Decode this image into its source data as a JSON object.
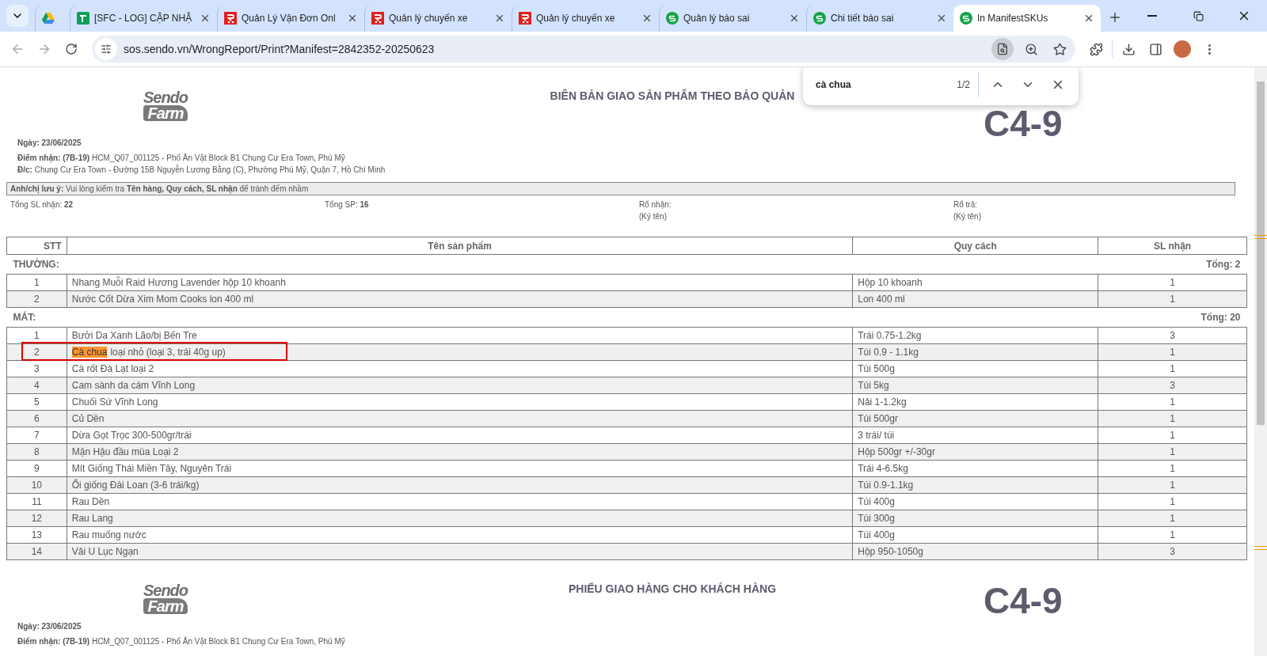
{
  "tabs": [
    {
      "kind": "drive",
      "selected": false
    },
    {
      "kind": "sheet",
      "title": "[SFC - LOG] CẬP NHẬ",
      "selected": false
    },
    {
      "kind": "cart",
      "title": "Quản Lý Vận Đơn Onl",
      "selected": false
    },
    {
      "kind": "cart",
      "title": "Quản lý chuyến xe",
      "selected": false
    },
    {
      "kind": "cart",
      "title": "Quản lý chuyến xe",
      "selected": false
    },
    {
      "kind": "circle",
      "title": "Quản lý báo sai",
      "selected": false
    },
    {
      "kind": "circle",
      "title": "Chi tiết báo sai",
      "selected": false
    },
    {
      "kind": "circle",
      "title": "In ManifestSKUs",
      "selected": true
    }
  ],
  "address": "sos.sendo.vn/WrongReport/Print?Manifest=2842352-20250623",
  "find_bar": {
    "query": "cà chua",
    "count": "1/2"
  },
  "report": {
    "logo": {
      "line1": "Sendo",
      "line2": "Farm"
    },
    "title": "BIÊN BẢN GIAO SẢN PHẨM THEO BẢO QUẢN",
    "code": "C4-9",
    "info": [
      "**Ngày: 23/06/2025**",
      "**Điểm nhận: (7B-19)** HCM_Q07_001125 - Phố Ăn Vặt Block B1 Chung Cư Era Town, Phú Mỹ",
      "**Đ/c:** Chung Cư Era Town - Đường 15B Nguyễn Lương Bằng (C), Phường Phú Mỹ, Quận 7, Hồ Chí Minh"
    ],
    "note": "**Anh/chị lưu ý:** Vui lòng kiểm tra **Tên hàng, Quy cách, SL nhận** để tránh đếm nhầm",
    "totals": [
      {
        "label": "Tổng SL nhận: **22**"
      },
      {
        "label": "Tổng SP: **16**"
      },
      {
        "label": "Rổ nhận:",
        "sub": "(Ký tên)"
      },
      {
        "label": "Rổ trả:",
        "sub": "(Ký tên)"
      }
    ],
    "columns": [
      "STT",
      "Tên sản phẩm",
      "Quy cách",
      "SL nhận"
    ],
    "sections": [
      {
        "label": "THƯỜNG:",
        "total": "Tổng: 2",
        "rows": [
          {
            "stt": "1",
            "name": "Nhang Muỗi Raid Hương Lavender hộp 10 khoanh",
            "spec": "Hộp 10 khoanh",
            "qty": "1"
          },
          {
            "stt": "2",
            "name": "Nước Cốt Dừa Xim Mom Cooks lon 400 ml",
            "spec": "Lon 400 ml",
            "qty": "1"
          }
        ]
      },
      {
        "label": "MÁT:",
        "total": "Tổng: 20",
        "rows": [
          {
            "stt": "1",
            "name": "Bưởi Da Xanh Lão/bị Bến Tre",
            "spec": "Trái 0.75-1.2kg",
            "qty": "3"
          },
          {
            "stt": "2",
            "match": "Cà chua",
            "name": "loại nhỏ (loại 3, trái 40g up)",
            "spec": "Túi 0.9 - 1.1kg",
            "qty": "1",
            "framed": true
          },
          {
            "stt": "3",
            "name": "Cà rốt Đà Lạt loại 2",
            "spec": "Túi 500g",
            "qty": "1"
          },
          {
            "stt": "4",
            "name": "Cam sành da cám Vĩnh Long",
            "spec": "Túi 5kg",
            "qty": "3"
          },
          {
            "stt": "5",
            "name": "Chuối Sứ Vĩnh Long",
            "spec": "Nải 1-1.2kg",
            "qty": "1"
          },
          {
            "stt": "6",
            "name": "Củ Dền",
            "spec": "Túi 500gr",
            "qty": "1"
          },
          {
            "stt": "7",
            "name": "Dừa Gọt Trọc 300-500gr/trái",
            "spec": "3 trái/ túi",
            "qty": "1"
          },
          {
            "stt": "8",
            "name": "Mận Hậu đầu mùa Loại 2",
            "spec": "Hộp 500gr +/-30gr",
            "qty": "1"
          },
          {
            "stt": "9",
            "name": "Mít Giống Thái Miền Tây, Nguyên Trái",
            "spec": "Trái 4-6.5kg",
            "qty": "1"
          },
          {
            "stt": "10",
            "name": "Ổi giống Đài Loan (3-6 trái/kg)",
            "spec": "Túi 0.9-1.1kg",
            "qty": "1"
          },
          {
            "stt": "11",
            "name": "Rau Dền",
            "spec": "Túi 400g",
            "qty": "1"
          },
          {
            "stt": "12",
            "name": "Rau Lang",
            "spec": "Túi 300g",
            "qty": "1"
          },
          {
            "stt": "13",
            "name": "Rau muống nước",
            "spec": "Túi 400g",
            "qty": "1"
          },
          {
            "stt": "14",
            "name": "Vải U Lục Ngạn",
            "spec": "Hộp 950-1050g",
            "qty": "3"
          }
        ]
      }
    ]
  },
  "receipt": {
    "logo": {
      "line1": "Sendo",
      "line2": "Farm"
    },
    "title": "PHIẾU GIAO HÀNG CHO KHÁCH HÀNG",
    "code": "C4-9",
    "info": [
      "**Ngày: 23/06/2025**",
      "**Điểm nhận: (7B-19)** HCM_Q07_001125 - Phố Ăn Vặt Block B1 Chung Cư Era Town, Phú Mỹ"
    ]
  }
}
